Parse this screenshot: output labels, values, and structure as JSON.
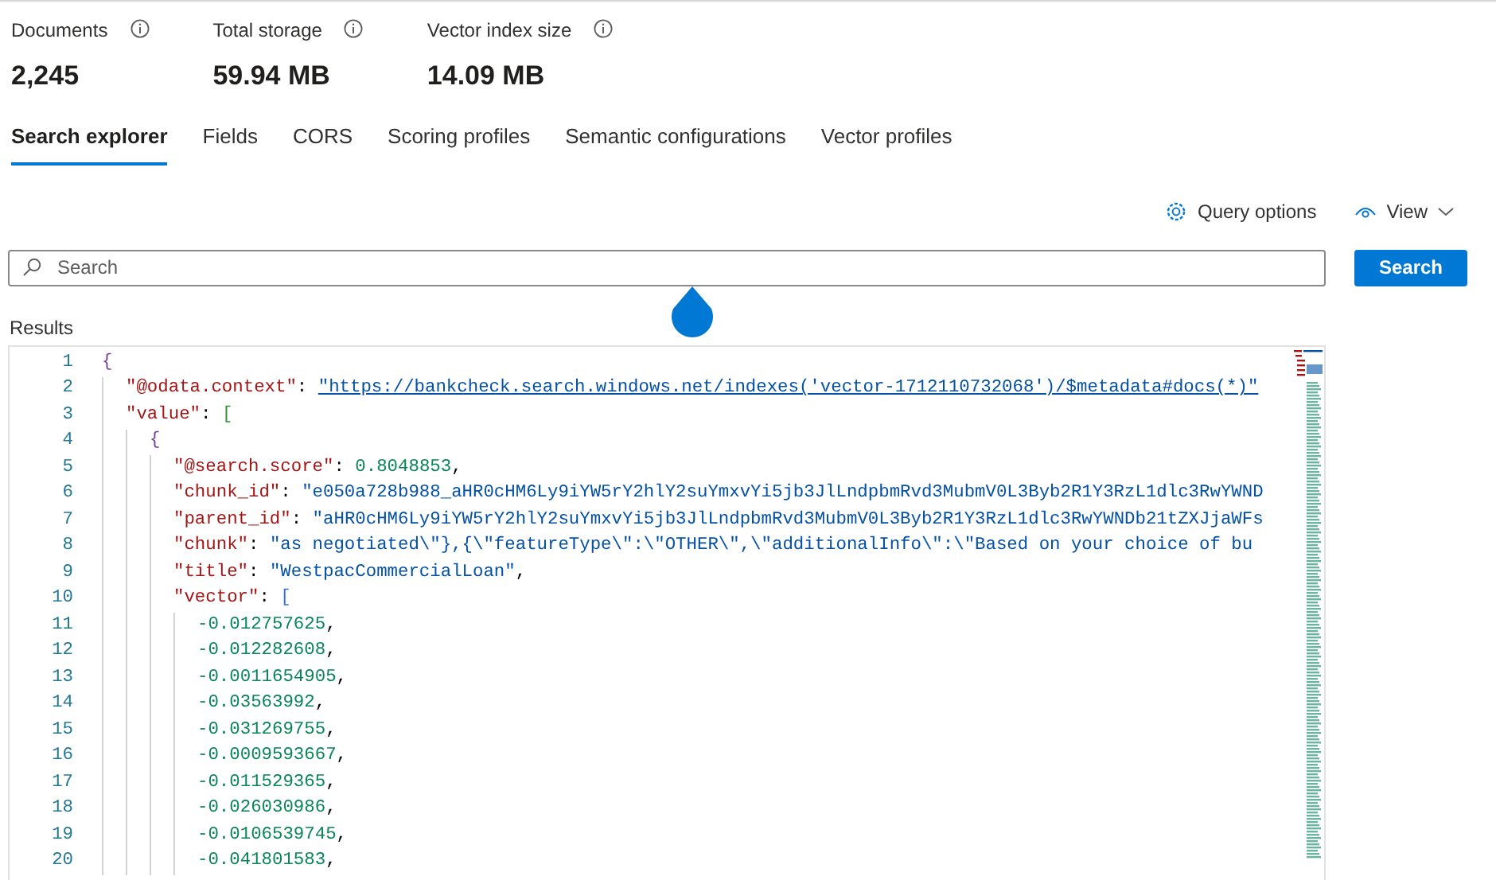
{
  "stats": [
    {
      "label": "Documents",
      "value": "2,245"
    },
    {
      "label": "Total storage",
      "value": "59.94 MB"
    },
    {
      "label": "Vector index size",
      "value": "14.09 MB"
    }
  ],
  "tabs": [
    {
      "label": "Search explorer",
      "selected": true
    },
    {
      "label": "Fields",
      "selected": false
    },
    {
      "label": "CORS",
      "selected": false
    },
    {
      "label": "Scoring profiles",
      "selected": false
    },
    {
      "label": "Semantic configurations",
      "selected": false
    },
    {
      "label": "Vector profiles",
      "selected": false
    }
  ],
  "toolbar": {
    "query_options": "Query options",
    "view": "View"
  },
  "search": {
    "placeholder": "Search",
    "button": "Search"
  },
  "results": {
    "label": "Results",
    "lines": [
      {
        "number": "1",
        "tokens": [
          {
            "kind": "bracket",
            "text": "{"
          }
        ],
        "children": [
          {
            "number": "2",
            "tokens": [
              {
                "kind": "key",
                "text": "\"@odata.context\""
              },
              {
                "kind": "punct",
                "text": ": "
              },
              {
                "kind": "link",
                "text": "\"https://bankcheck.search.windows.net/indexes('vector-1712110732068')/$metadata#docs(*)\""
              }
            ]
          },
          {
            "number": "3",
            "tokens": [
              {
                "kind": "key",
                "text": "\"value\""
              },
              {
                "kind": "punct",
                "text": ": "
              },
              {
                "kind": "bracket",
                "text": "["
              }
            ],
            "children": [
              {
                "number": "4",
                "tokens": [
                  {
                    "kind": "bracket",
                    "text": "{"
                  }
                ],
                "children": [
                  {
                    "number": "5",
                    "tokens": [
                      {
                        "kind": "key",
                        "text": "\"@search.score\""
                      },
                      {
                        "kind": "punct",
                        "text": ": "
                      },
                      {
                        "kind": "number",
                        "text": "0.8048853"
                      },
                      {
                        "kind": "punct",
                        "text": ","
                      }
                    ]
                  },
                  {
                    "number": "6",
                    "tokens": [
                      {
                        "kind": "key",
                        "text": "\"chunk_id\""
                      },
                      {
                        "kind": "punct",
                        "text": ": "
                      },
                      {
                        "kind": "string",
                        "text": "\"e050a728b988_aHR0cHM6Ly9iYW5rY2hlY2suYmxvYi5jb3JlLndpbmRvd3MubmV0L3Byb2R1Y3RzL1dlc3RwYWND"
                      }
                    ]
                  },
                  {
                    "number": "7",
                    "tokens": [
                      {
                        "kind": "key",
                        "text": "\"parent_id\""
                      },
                      {
                        "kind": "punct",
                        "text": ": "
                      },
                      {
                        "kind": "string",
                        "text": "\"aHR0cHM6Ly9iYW5rY2hlY2suYmxvYi5jb3JlLndpbmRvd3MubmV0L3Byb2R1Y3RzL1dlc3RwYWNDb21tZXJjaWFs"
                      }
                    ]
                  },
                  {
                    "number": "8",
                    "tokens": [
                      {
                        "kind": "key",
                        "text": "\"chunk\""
                      },
                      {
                        "kind": "punct",
                        "text": ": "
                      },
                      {
                        "kind": "string",
                        "text": "\"as negotiated\\\"},{\\\"featureType\\\":\\\"OTHER\\\",\\\"additionalInfo\\\":\\\"Based on your choice of bu"
                      }
                    ]
                  },
                  {
                    "number": "9",
                    "tokens": [
                      {
                        "kind": "key",
                        "text": "\"title\""
                      },
                      {
                        "kind": "punct",
                        "text": ": "
                      },
                      {
                        "kind": "string",
                        "text": "\"WestpacCommercialLoan\""
                      },
                      {
                        "kind": "punct",
                        "text": ","
                      }
                    ]
                  },
                  {
                    "number": "10",
                    "tokens": [
                      {
                        "kind": "key",
                        "text": "\"vector\""
                      },
                      {
                        "kind": "punct",
                        "text": ": "
                      },
                      {
                        "kind": "bracket",
                        "text": "["
                      }
                    ],
                    "children": [
                      {
                        "number": "11",
                        "tokens": [
                          {
                            "kind": "number",
                            "text": "-0.012757625"
                          },
                          {
                            "kind": "punct",
                            "text": ","
                          }
                        ]
                      },
                      {
                        "number": "12",
                        "tokens": [
                          {
                            "kind": "number",
                            "text": "-0.012282608"
                          },
                          {
                            "kind": "punct",
                            "text": ","
                          }
                        ]
                      },
                      {
                        "number": "13",
                        "tokens": [
                          {
                            "kind": "number",
                            "text": "-0.0011654905"
                          },
                          {
                            "kind": "punct",
                            "text": ","
                          }
                        ]
                      },
                      {
                        "number": "14",
                        "tokens": [
                          {
                            "kind": "number",
                            "text": "-0.03563992"
                          },
                          {
                            "kind": "punct",
                            "text": ","
                          }
                        ]
                      },
                      {
                        "number": "15",
                        "tokens": [
                          {
                            "kind": "number",
                            "text": "-0.031269755"
                          },
                          {
                            "kind": "punct",
                            "text": ","
                          }
                        ]
                      },
                      {
                        "number": "16",
                        "tokens": [
                          {
                            "kind": "number",
                            "text": "-0.0009593667"
                          },
                          {
                            "kind": "punct",
                            "text": ","
                          }
                        ]
                      },
                      {
                        "number": "17",
                        "tokens": [
                          {
                            "kind": "number",
                            "text": "-0.011529365"
                          },
                          {
                            "kind": "punct",
                            "text": ","
                          }
                        ]
                      },
                      {
                        "number": "18",
                        "tokens": [
                          {
                            "kind": "number",
                            "text": "-0.026030986"
                          },
                          {
                            "kind": "punct",
                            "text": ","
                          }
                        ]
                      },
                      {
                        "number": "19",
                        "tokens": [
                          {
                            "kind": "number",
                            "text": "-0.0106539745"
                          },
                          {
                            "kind": "punct",
                            "text": ","
                          }
                        ]
                      },
                      {
                        "number": "20",
                        "tokens": [
                          {
                            "kind": "number",
                            "text": "-0.041801583"
                          },
                          {
                            "kind": "punct",
                            "text": ","
                          }
                        ]
                      }
                    ]
                  }
                ]
              }
            ]
          }
        ]
      }
    ]
  }
}
